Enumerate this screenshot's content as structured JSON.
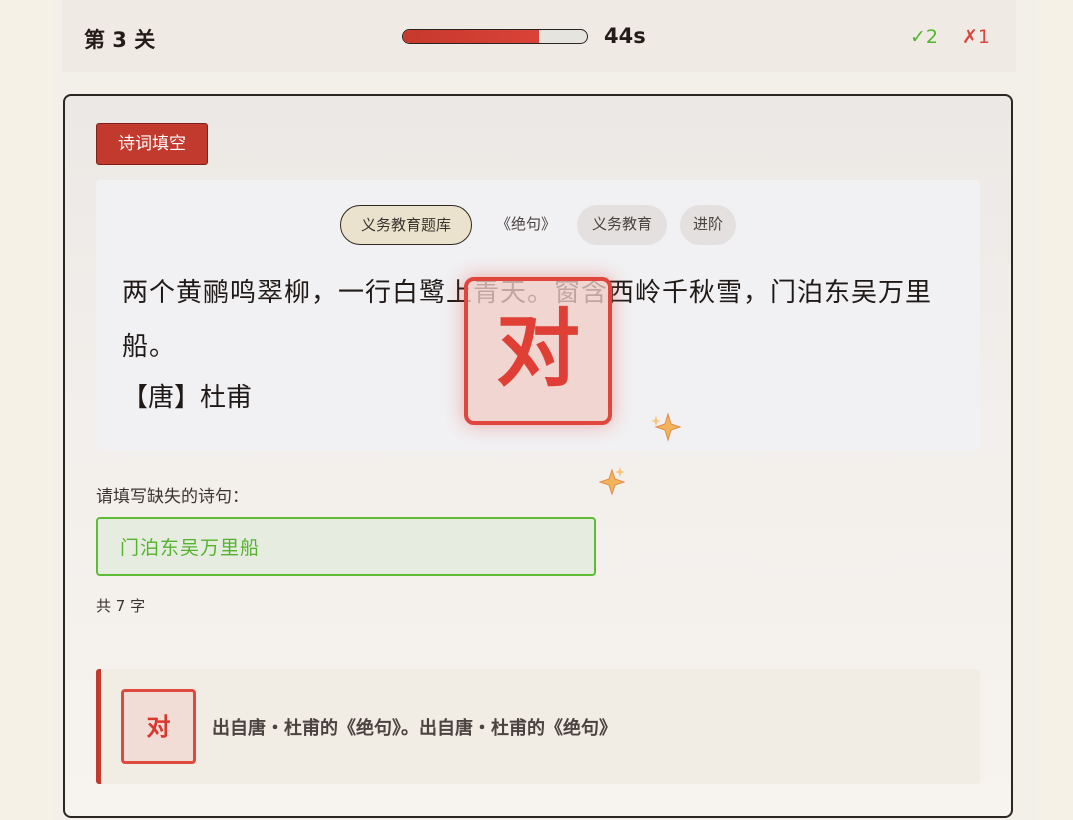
{
  "header": {
    "level": "第 3 关",
    "progress_fraction": 0.74,
    "timer": "44s",
    "correct": "✓2",
    "wrong": "✗1"
  },
  "question": {
    "type_tag": "诗词填空",
    "tags": {
      "bank": "义务教育题库",
      "title": "《绝句》",
      "education": "义务教育",
      "difficulty": "进阶"
    },
    "poem_text": "两个黄鹂鸣翠柳，一行白鹭上青天。窗含西岭千秋雪，门泊东吴万里船。",
    "author": "【唐】杜甫",
    "prompt": "请填写缺失的诗句：",
    "answer_value": "门泊东吴万里船",
    "answer_placeholder": "",
    "char_count": "共 7 字"
  },
  "result": {
    "seal_text": "对",
    "feedback_seal": "对",
    "feedback_text": "出自唐・杜甫的《绝句》。出自唐・杜甫的《绝句》"
  },
  "colors": {
    "accent_red": "#c23a2d",
    "correct_green": "#52b52b",
    "wrong_red": "#d9473c"
  }
}
